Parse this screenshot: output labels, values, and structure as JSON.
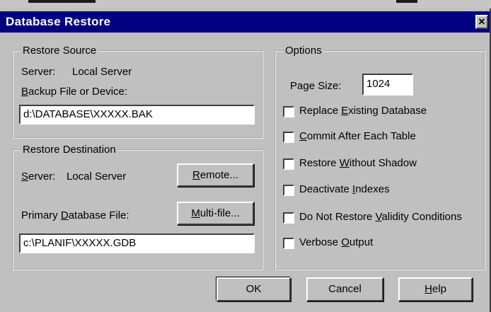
{
  "window": {
    "title": "Database Restore",
    "close_glyph": "✕"
  },
  "restore_source": {
    "legend": "Restore Source",
    "server_label": "Server:",
    "server_value": "Local Server",
    "backup_label_prefix": "",
    "backup_label_accel": "B",
    "backup_label_rest": "ackup File or Device:",
    "backup_value": "d:\\DATABASE\\XXXXX.BAK"
  },
  "restore_destination": {
    "legend": "Restore Destination",
    "server_label_accel": "S",
    "server_label_rest": "erver:",
    "server_value": "Local Server",
    "remote_button": {
      "prefix": "",
      "accel": "R",
      "rest": "emote..."
    },
    "multifile_button": {
      "prefix": "",
      "accel": "M",
      "rest": "ulti-file..."
    },
    "primary_label_prefix": "Primary ",
    "primary_label_accel": "D",
    "primary_label_rest": "atabase File:",
    "primary_value": "c:\\PLANIF\\XXXXX.GDB"
  },
  "options": {
    "legend": "Options",
    "page_size_label": "Page Size:",
    "page_size_value": "1024",
    "checkboxes": [
      {
        "prefix": "Replace ",
        "accel": "E",
        "rest": "xisting Database",
        "checked": false
      },
      {
        "prefix": "",
        "accel": "C",
        "rest": "ommit After Each Table",
        "checked": false
      },
      {
        "prefix": "Restore ",
        "accel": "W",
        "rest": "ithout Shadow",
        "checked": false
      },
      {
        "prefix": "Deactivate ",
        "accel": "I",
        "rest": "ndexes",
        "checked": false
      },
      {
        "prefix": "Do Not Restore ",
        "accel": "V",
        "rest": "alidity Conditions",
        "checked": false
      },
      {
        "prefix": "Verbose ",
        "accel": "O",
        "rest": "utput",
        "checked": false
      }
    ]
  },
  "buttons": {
    "ok": "OK",
    "cancel": "Cancel",
    "help_accel": "H",
    "help_rest": "elp"
  }
}
